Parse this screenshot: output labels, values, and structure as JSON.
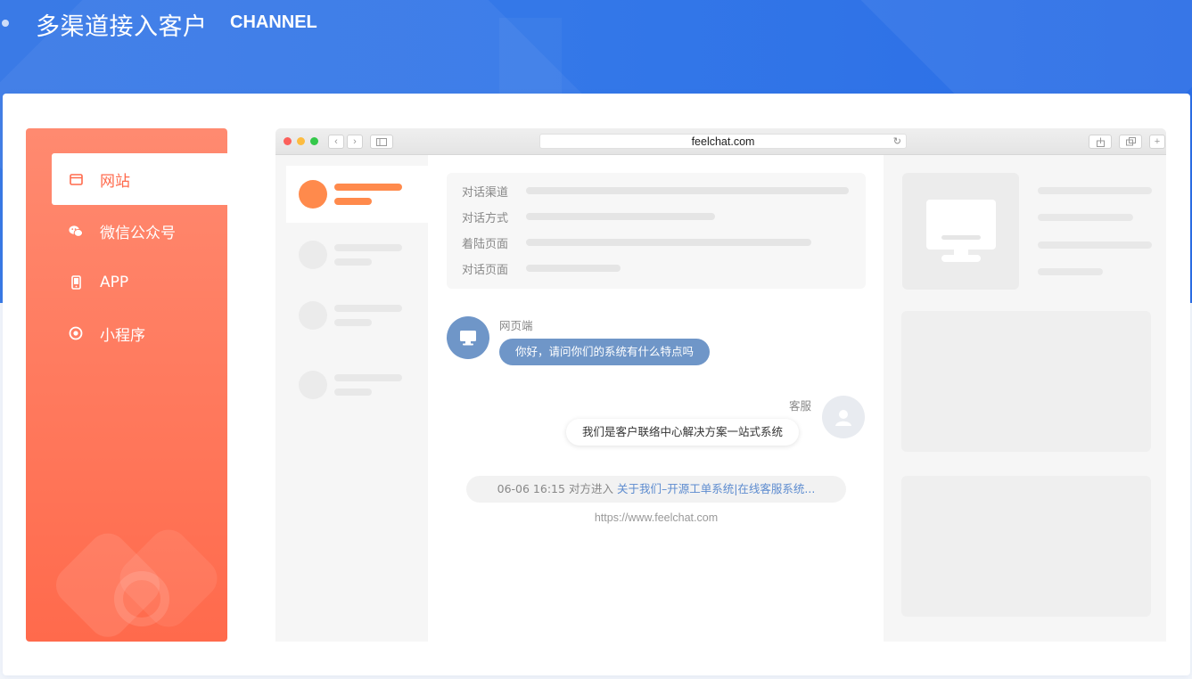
{
  "header": {
    "title": "多渠道接入客户",
    "subtitle": "CHANNEL"
  },
  "colors": {
    "banner": "#3478e8",
    "sidebar_top": "#ff8a70",
    "sidebar_bottom": "#ff6a4c",
    "active_text": "#ff6a4c",
    "incoming_bubble": "#6f96c8",
    "link": "#5c8bcf"
  },
  "sidebar": {
    "items": [
      {
        "label": "网站",
        "icon": "browser-window-icon",
        "active": true
      },
      {
        "label": "微信公众号",
        "icon": "wechat-icon",
        "active": false
      },
      {
        "label": "APP",
        "icon": "phone-icon",
        "active": false
      },
      {
        "label": "小程序",
        "icon": "mini-program-icon",
        "active": false
      }
    ]
  },
  "browser": {
    "url": "feelchat.com",
    "info": {
      "rows": [
        {
          "label": "对话渠道"
        },
        {
          "label": "对话方式"
        },
        {
          "label": "着陆页面"
        },
        {
          "label": "对话页面"
        }
      ]
    },
    "messages": {
      "visitor_name": "网页端",
      "visitor_text": "你好，请问你们的系统有什么特点吗",
      "agent_name": "客服",
      "agent_text": "我们是客户联络中心解决方案一站式系统"
    },
    "notice": {
      "time": "06-06 16:15",
      "action": "对方进入",
      "link_text": "关于我们–开源工单系统|在线客服系统...",
      "url": "https://www.feelchat.com"
    }
  }
}
